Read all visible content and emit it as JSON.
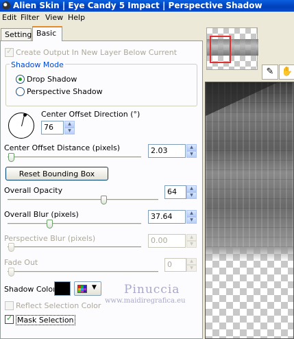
{
  "window": {
    "title": "Alien Skin | Eye Candy 5 Impact | Perspective Shadow"
  },
  "menu": {
    "edit": "Edit",
    "filter": "Filter",
    "view": "View",
    "help": "Help"
  },
  "tabs": {
    "settings": "Settings",
    "basic": "Basic"
  },
  "basic": {
    "create_output_label": "Create Output In New Layer Below Current",
    "create_output_checked": true,
    "shadow_mode": {
      "label": "Shadow Mode",
      "drop_shadow": "Drop Shadow",
      "perspective_shadow": "Perspective Shadow",
      "selected": "Drop Shadow"
    },
    "center_offset_direction": {
      "label": "Center Offset Direction (°)",
      "value": "76"
    },
    "center_offset_distance": {
      "label": "Center Offset Distance (pixels)",
      "value": "2.03"
    },
    "reset_bounding_box": "Reset Bounding Box",
    "overall_opacity": {
      "label": "Overall Opacity",
      "value": "64"
    },
    "overall_blur": {
      "label": "Overall Blur (pixels)",
      "value": "37.64"
    },
    "perspective_blur": {
      "label": "Perspective Blur (pixels)",
      "value": "0.00"
    },
    "fade_out": {
      "label": "Fade Out",
      "value": "0"
    },
    "shadow_color": {
      "label": "Shadow Color",
      "color": "#000000"
    },
    "reflect_selection_color": {
      "label": "Reflect Selection Color",
      "checked": false
    },
    "mask_selection": {
      "label": "Mask Selection",
      "checked": true
    }
  },
  "watermark": {
    "name": "Pinuccia",
    "url": "www.maidiregrafica.eu"
  },
  "colors": {
    "title_bar": "#0a4cd0",
    "accent_tab": "#e68b2c",
    "group_label": "#0046d5",
    "nav_frame": "#e03030"
  },
  "icons": {
    "tool_1": "eyedropper-icon",
    "tool_2": "hand-icon"
  }
}
